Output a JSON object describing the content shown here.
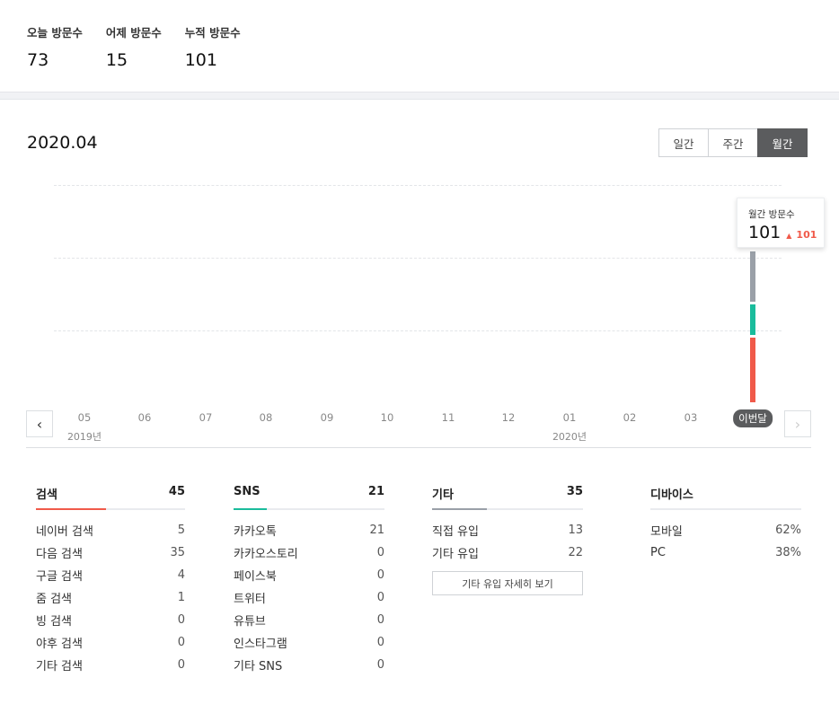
{
  "stats": [
    {
      "label": "오늘 방문수",
      "value": "73"
    },
    {
      "label": "어제 방문수",
      "value": "15"
    },
    {
      "label": "누적 방문수",
      "value": "101"
    }
  ],
  "period": "2020.04",
  "tabs": [
    "일간",
    "주간",
    "월간"
  ],
  "active_tab": "월간",
  "tooltip": {
    "label": "월간 방문수",
    "value": "101",
    "delta": "101"
  },
  "nav": {
    "prev_icon": "chevron-left-icon",
    "next_icon": "chevron-right-icon"
  },
  "chart_data": {
    "type": "bar",
    "stacked": true,
    "categories": [
      "05",
      "06",
      "07",
      "08",
      "09",
      "10",
      "11",
      "12",
      "01",
      "02",
      "03",
      "이번달"
    ],
    "year_labels": [
      "2019년",
      "2020년"
    ],
    "series": [
      {
        "color": "#f05a4a",
        "values": [
          0,
          0,
          0,
          0,
          0,
          0,
          0,
          0,
          0,
          0,
          0,
          45
        ]
      },
      {
        "color": "#1abc9c",
        "values": [
          0,
          0,
          0,
          0,
          0,
          0,
          0,
          0,
          0,
          0,
          0,
          21
        ]
      },
      {
        "color": "#9aa0a8",
        "values": [
          0,
          0,
          0,
          0,
          0,
          0,
          0,
          0,
          0,
          0,
          0,
          35
        ]
      }
    ],
    "grid": true
  },
  "panels": [
    {
      "title": "검색",
      "total": "45",
      "accent": "#f05a4a",
      "rows": [
        {
          "label": "네이버 검색",
          "value": "5"
        },
        {
          "label": "다음 검색",
          "value": "35"
        },
        {
          "label": "구글 검색",
          "value": "4"
        },
        {
          "label": "줌 검색",
          "value": "1"
        },
        {
          "label": "빙 검색",
          "value": "0"
        },
        {
          "label": "야후 검색",
          "value": "0"
        },
        {
          "label": "기타 검색",
          "value": "0"
        }
      ]
    },
    {
      "title": "SNS",
      "total": "21",
      "accent": "#1abc9c",
      "rows": [
        {
          "label": "카카오톡",
          "value": "21"
        },
        {
          "label": "카카오스토리",
          "value": "0"
        },
        {
          "label": "페이스북",
          "value": "0"
        },
        {
          "label": "트위터",
          "value": "0"
        },
        {
          "label": "유튜브",
          "value": "0"
        },
        {
          "label": "인스타그램",
          "value": "0"
        },
        {
          "label": "기타 SNS",
          "value": "0"
        }
      ]
    },
    {
      "title": "기타",
      "total": "35",
      "accent": "#9aa0a8",
      "rows": [
        {
          "label": "직접 유입",
          "value": "13"
        },
        {
          "label": "기타 유입",
          "value": "22"
        }
      ],
      "button": "기타 유입 자세히 보기"
    },
    {
      "title": "디바이스",
      "total": "",
      "rows": [
        {
          "label": "모바일",
          "value": "62%"
        },
        {
          "label": "PC",
          "value": "38%"
        }
      ]
    }
  ]
}
